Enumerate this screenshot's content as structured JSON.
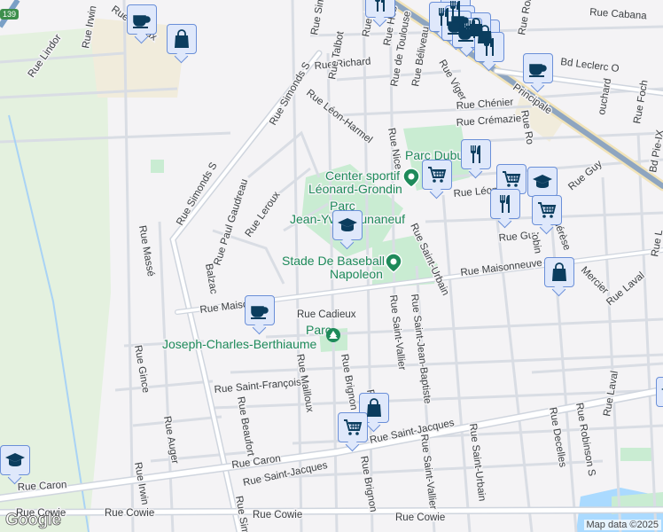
{
  "map": {
    "highway_shield": "139",
    "attribution": "Map data ©2025",
    "logo": "Google",
    "colors": {
      "park": "#c9ecd2",
      "marker_bg": "#dfe8fb",
      "marker_border": "#6a8fd8",
      "icon": "#0b3d5e",
      "poi_text": "#1e8a5a"
    },
    "streets": {
      "cabana": "Rue Cabana",
      "leclerc": "Bd Leclerc O",
      "principale": "Principale",
      "chenier": "Rue Chénier",
      "cremazie": "Rue Crémazie",
      "richard": "Rue Richard",
      "toulouse": "Rue de Toulouse",
      "beliveau": "Rue Béliveau",
      "viger": "Rue Viger",
      "hebert": "Rue Héb",
      "rue_a": "Rue A",
      "talbot": "Rue Talbot",
      "leon_harmel": "Rue Léon-Harmel",
      "simonds_top": "Rue Simonds S",
      "simonds_mid": "Rue Simonds S",
      "simonds_bottom": "Rue Sim",
      "lindor": "Rue Lindor",
      "irwin_top": "Rue Irwin",
      "irwin_bottom": "Rue Irwin",
      "leroux_top": "Rue Leroux",
      "leroux": "Rue Leroux",
      "paul_gaudreau": "Rue Paul Gaudreau",
      "masse": "Rue Massé",
      "balzac": "Balzac",
      "maisonneuve_left": "Rue Maiso",
      "maisonneuve_right": "Rue Maisonneuve",
      "cadieux": "Rue Cadieux",
      "nice": "Rue Nice",
      "saint_urbain_top": "Rue Saint-Urbain",
      "saint_urbain_bottom": "Rue Saint-Urbain",
      "saint_vallier_top": "Rue Saint-Vallier",
      "saint_vallier_bottom": "Rue Saint-Vallier",
      "saint_jean_baptiste": "Rue Saint-Jean-Baptiste",
      "leon": "Rue Léon",
      "guy_right": "Rue Guy",
      "guy": "Rue Guy",
      "robinson_top": "Rue Robins",
      "robinson_mid": "Rue Ro",
      "robin": "obin",
      "robinson_bottom": "Rue Robinson S",
      "bouchard": "ouchard",
      "foch": "Rue Foch",
      "pie_ix": "Bd Pie-IX",
      "therese": "hérèse",
      "mercier": "Mercier",
      "laval_top": "Rue Laval",
      "laval": "Rue Laval",
      "rue_l": "Rue L",
      "gince": "Rue Gince",
      "saint_francois": "Rue Saint-François",
      "mailloux": "Rue Mailloux",
      "brignon_top": "Rue Brignon",
      "brignon_bottom": "Rue Brignon",
      "beaufort": "Rue Beaufort",
      "auger": "Rue Auger",
      "caron_left": "Rue Caron",
      "caron": "Rue Caron",
      "saint_jacques_left": "Rue Saint-Jacques",
      "saint_jacques_right": "Rue Saint-Jacques",
      "cowie_left": "Rue Cowie",
      "cowie_mid": "Rue Cowie",
      "cowie_right": "Rue Cowie",
      "decelles": "Rue Decelles",
      "r_small": "R"
    },
    "places": {
      "parc_dubuc": "Parc Dubuc",
      "centre_sportif_1": "Center sportif",
      "centre_sportif_2": "Léonard-Grondin",
      "parc_jy_1": "Parc",
      "parc_jy_2": "Jean-Yves Dunaneuf",
      "stade_1": "Stade De Baseball",
      "stade_2": "Napoleon",
      "parc_jcb_1": "Parc",
      "parc_jcb_2": "Joseph-Charles-Berthiaume"
    },
    "markers": [
      {
        "type": "cafe"
      },
      {
        "type": "shopping"
      },
      {
        "type": "restaurant"
      },
      {
        "type": "restaurant"
      },
      {
        "type": "restaurant"
      },
      {
        "type": "cafe"
      },
      {
        "type": "restaurant"
      },
      {
        "type": "shopping"
      },
      {
        "type": "shopping"
      },
      {
        "type": "cafe"
      },
      {
        "type": "cafe"
      },
      {
        "type": "restaurant"
      },
      {
        "type": "cafe"
      },
      {
        "type": "grocery"
      },
      {
        "type": "school"
      },
      {
        "type": "grocery"
      },
      {
        "type": "restaurant"
      },
      {
        "type": "grocery"
      },
      {
        "type": "school"
      },
      {
        "type": "restaurant"
      },
      {
        "type": "shopping"
      },
      {
        "type": "cafe"
      },
      {
        "type": "shopping"
      },
      {
        "type": "grocery"
      },
      {
        "type": "school"
      },
      {
        "type": "school"
      }
    ]
  }
}
